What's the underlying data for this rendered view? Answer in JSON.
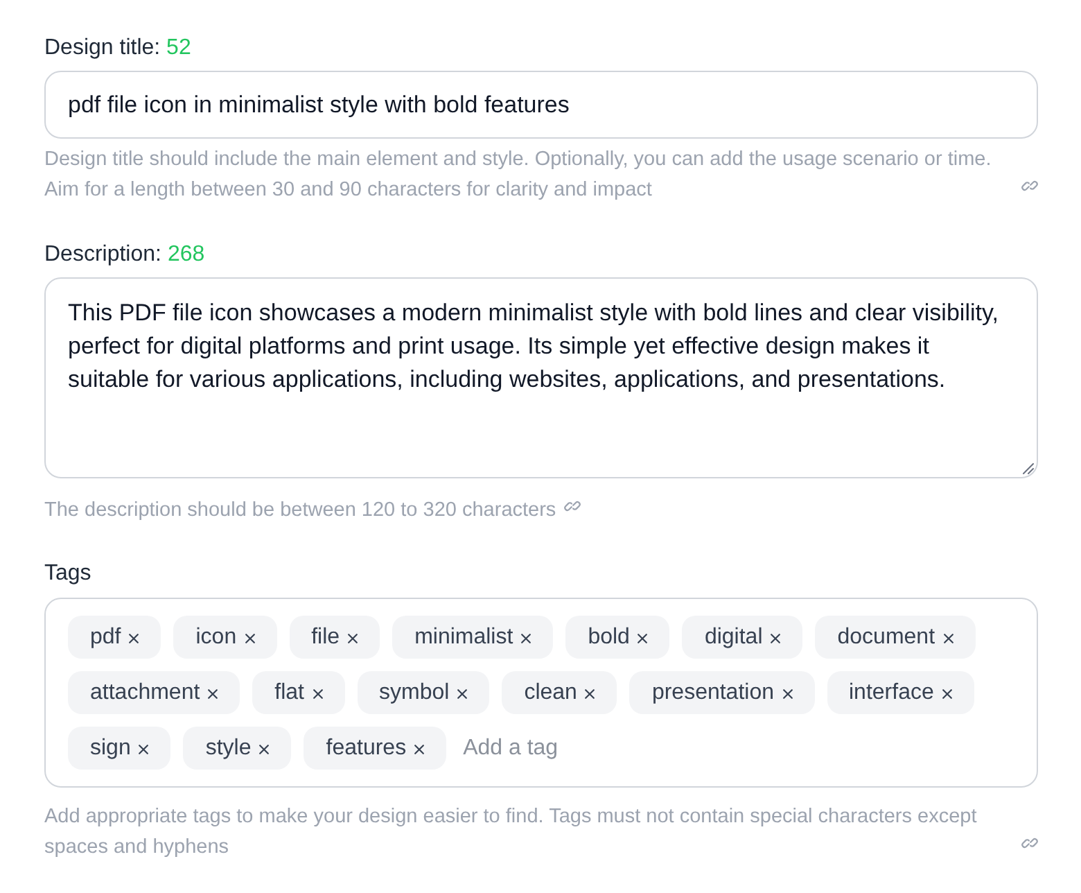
{
  "fields": [
    {
      "kind": "text_input",
      "label": "Design title:",
      "count": "52",
      "value": "pdf file icon in minimalist style with bold features",
      "hint": "Design title should include the main element and style. Optionally, you can add the usage scenario or time. Aim for a length between 30 and 90 characters for clarity and impact"
    },
    {
      "kind": "textarea",
      "label": "Description:",
      "count": "268",
      "value": "This PDF file icon showcases a modern minimalist style with bold lines and clear visibility, perfect for digital platforms and print usage. Its simple yet effective design makes it suitable for various applications, including websites, applications, and presentations.",
      "hint": "The description should be between 120 to 320 characters"
    },
    {
      "kind": "tags",
      "label": "Tags",
      "tags": [
        "pdf",
        "icon",
        "file",
        "minimalist",
        "bold",
        "digital",
        "document",
        "attachment",
        "flat",
        "symbol",
        "clean",
        "presentation",
        "interface",
        "sign",
        "style",
        "features"
      ],
      "placeholder": "Add a tag",
      "hint": "Add appropriate tags to make your design easier to find. Tags must not contain special characters except spaces and hyphens"
    }
  ]
}
